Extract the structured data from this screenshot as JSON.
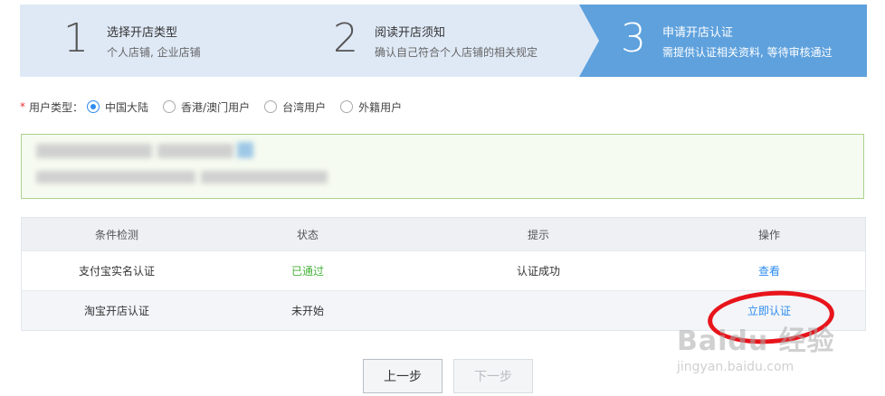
{
  "steps": [
    {
      "num": "1",
      "title": "选择开店类型",
      "desc": "个人店铺, 企业店铺"
    },
    {
      "num": "2",
      "title": "阅读开店须知",
      "desc": "确认自己符合个人店铺的相关规定"
    },
    {
      "num": "3",
      "title": "申请开店认证",
      "desc": "需提供认证相关资料, 等待审核通过"
    }
  ],
  "user_type": {
    "required_mark": "*",
    "label": "用户类型：",
    "options": [
      {
        "label": "中国大陆",
        "checked": true
      },
      {
        "label": "香港/澳门用户",
        "checked": false
      },
      {
        "label": "台湾用户",
        "checked": false
      },
      {
        "label": "外籍用户",
        "checked": false
      }
    ]
  },
  "table": {
    "headers": [
      "条件检测",
      "状态",
      "提示",
      "操作"
    ],
    "rows": [
      {
        "check": "支付宝实名认证",
        "status": "已通过",
        "tip": "认证成功",
        "action": "查看"
      },
      {
        "check": "淘宝开店认证",
        "status": "未开始",
        "tip": "",
        "action": "立即认证"
      }
    ]
  },
  "buttons": {
    "prev": "上一步",
    "next": "下一步"
  },
  "watermark": {
    "brand": "Baidu 经验",
    "url": "jingyan.baidu.com"
  },
  "colors": {
    "accent": "#2d8cf0",
    "success": "#46b23a",
    "active_step": "#5ea1dd",
    "annotation": "#e8141b"
  }
}
